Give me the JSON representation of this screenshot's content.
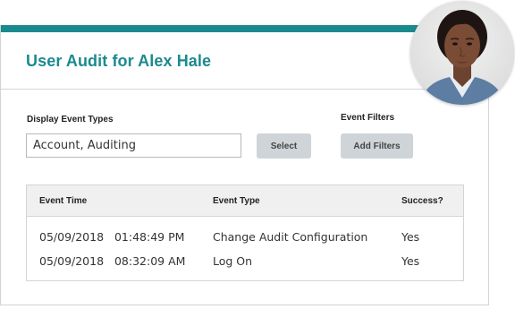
{
  "header": {
    "title": "User Audit for Alex Hale",
    "accent_color": "#1b8a8f"
  },
  "filters": {
    "event_types_label": "Display Event Types",
    "event_types_value": "Account, Auditing",
    "select_button": "Select",
    "event_filters_label": "Event Filters",
    "add_filters_button": "Add Filters"
  },
  "table": {
    "columns": [
      "Event Time",
      "Event Type",
      "Success?"
    ],
    "rows": [
      {
        "time": "05/09/2018   01:48:49 PM",
        "type": "Change Audit Configuration",
        "success": "Yes"
      },
      {
        "time": "05/09/2018   08:32:09 AM",
        "type": "Log On",
        "success": "Yes"
      }
    ]
  },
  "avatar": {
    "icon": "user-photo"
  }
}
